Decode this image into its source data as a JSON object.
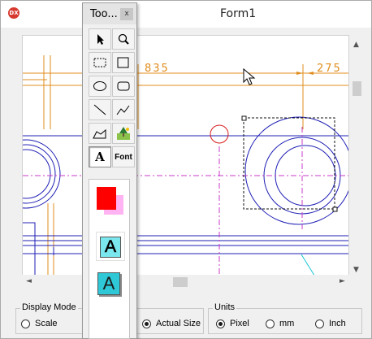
{
  "window": {
    "title": "Form1",
    "icon": "dx-app-icon",
    "icon_text": "DX"
  },
  "canvas": {
    "dimensions": [
      "835",
      "275"
    ],
    "line_color": "#e08c1c",
    "shape_color": "#1f1fb5",
    "center_line_color": "#c83ac8",
    "marker_color": "#d81b1b",
    "leader_color": "#19c6d6"
  },
  "scrollbars": {
    "up": "▲",
    "down": "▼",
    "left": "◄",
    "right": "►"
  },
  "toolbox": {
    "title": "Too...",
    "close_label": "x",
    "tools": [
      {
        "name": "select-tool",
        "icon": "arrow-pointer-icon"
      },
      {
        "name": "zoom-tool",
        "icon": "magnifier-icon"
      },
      {
        "name": "selection-rectangle-tool",
        "icon": "dashed-rectangle-icon"
      },
      {
        "name": "rectangle-tool",
        "icon": "rectangle-icon"
      },
      {
        "name": "ellipse-tool",
        "icon": "ellipse-icon"
      },
      {
        "name": "rounded-rectangle-tool",
        "icon": "rounded-rectangle-icon"
      },
      {
        "name": "line-tool",
        "icon": "line-icon"
      },
      {
        "name": "polyline-tool",
        "icon": "polyline-icon"
      },
      {
        "name": "polygon-tool",
        "icon": "polygon-icon"
      },
      {
        "name": "image-tool",
        "icon": "picture-icon"
      },
      {
        "name": "text-tool",
        "icon": "letter-a-icon",
        "label": "A"
      },
      {
        "name": "font-tool",
        "icon": "font-icon",
        "label": "Font"
      }
    ],
    "colors": {
      "foreground": "#ff0000",
      "background": "#ffb3f2",
      "text_swatch_light": "#7ae6ee",
      "text_swatch_dark": "#2ec8d6"
    },
    "swatch_letter": "A"
  },
  "display_mode": {
    "title": "Display Mode",
    "options": [
      {
        "label": "Scale",
        "checked": false
      },
      {
        "label": "Actual Size",
        "checked": true
      }
    ]
  },
  "units": {
    "title": "Units",
    "options": [
      {
        "label": "Pixel",
        "checked": true
      },
      {
        "label": "mm",
        "checked": false
      },
      {
        "label": "Inch",
        "checked": false
      }
    ]
  }
}
